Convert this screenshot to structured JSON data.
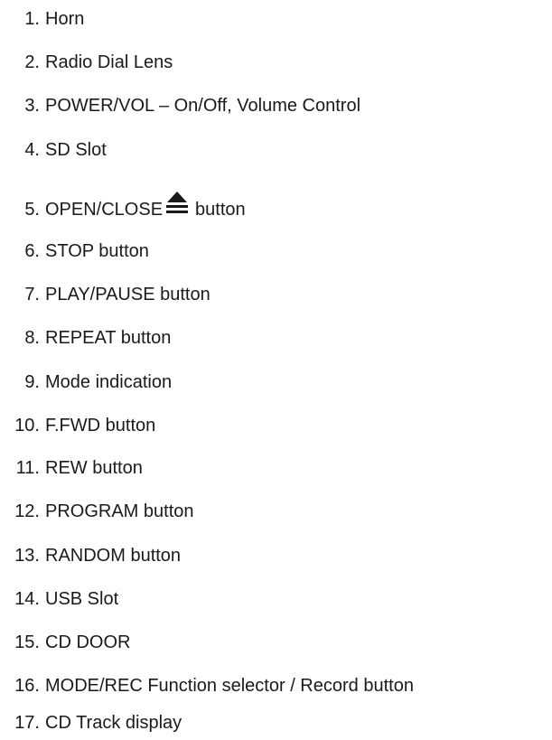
{
  "items": [
    {
      "num": "1.",
      "label": "Horn"
    },
    {
      "num": "2.",
      "label": "Radio Dial Lens"
    },
    {
      "num": "3.",
      "label": "POWER/VOL – On/Off, Volume Control"
    },
    {
      "num": "4.",
      "label": "SD Slot"
    },
    {
      "num": "5.",
      "label": "OPEN/CLOSE",
      "icon": "eject-icon",
      "suffix": "button"
    },
    {
      "num": "6.",
      "label": "STOP button"
    },
    {
      "num": "7.",
      "label": "PLAY/PAUSE button"
    },
    {
      "num": "8.",
      "label": "REPEAT button"
    },
    {
      "num": "9.",
      "label": "Mode indication"
    },
    {
      "num": "10.",
      "label": "F.FWD button"
    },
    {
      "num": "11.",
      "label": "REW button"
    },
    {
      "num": "12.",
      "label": "PROGRAM button"
    },
    {
      "num": "13.",
      "label": "RANDOM button"
    },
    {
      "num": "14.",
      "label": "USB Slot"
    },
    {
      "num": "15.",
      "label": "CD DOOR"
    },
    {
      "num": "16.",
      "label": "MODE/REC Function selector / Record button"
    },
    {
      "num": "17.",
      "label": "CD Track display"
    }
  ]
}
